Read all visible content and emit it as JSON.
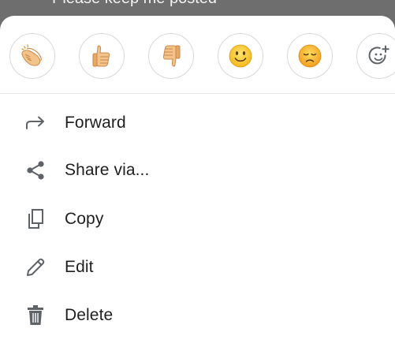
{
  "backdrop": {
    "message_text": "Please keep me posted"
  },
  "reactions": [
    {
      "icon": "clapping-hands-icon"
    },
    {
      "icon": "thumbs-up-icon"
    },
    {
      "icon": "thumbs-down-icon"
    },
    {
      "icon": "smiling-face-icon"
    },
    {
      "icon": "disappointed-face-icon"
    },
    {
      "icon": "add-reaction-icon"
    }
  ],
  "menu": {
    "items": [
      {
        "label": "Forward",
        "icon": "forward-arrow-icon"
      },
      {
        "label": "Share via...",
        "icon": "share-icon"
      },
      {
        "label": "Copy",
        "icon": "copy-icon"
      },
      {
        "label": "Edit",
        "icon": "pencil-icon"
      },
      {
        "label": "Delete",
        "icon": "trash-icon"
      }
    ]
  },
  "colors": {
    "skin": "#f2c38a",
    "skin_shadow": "#d99a55",
    "face_yellow": "#f7c52d",
    "face_orange": "#f5a623",
    "icon_gray": "#5f6368",
    "text": "#1f1f1f"
  }
}
